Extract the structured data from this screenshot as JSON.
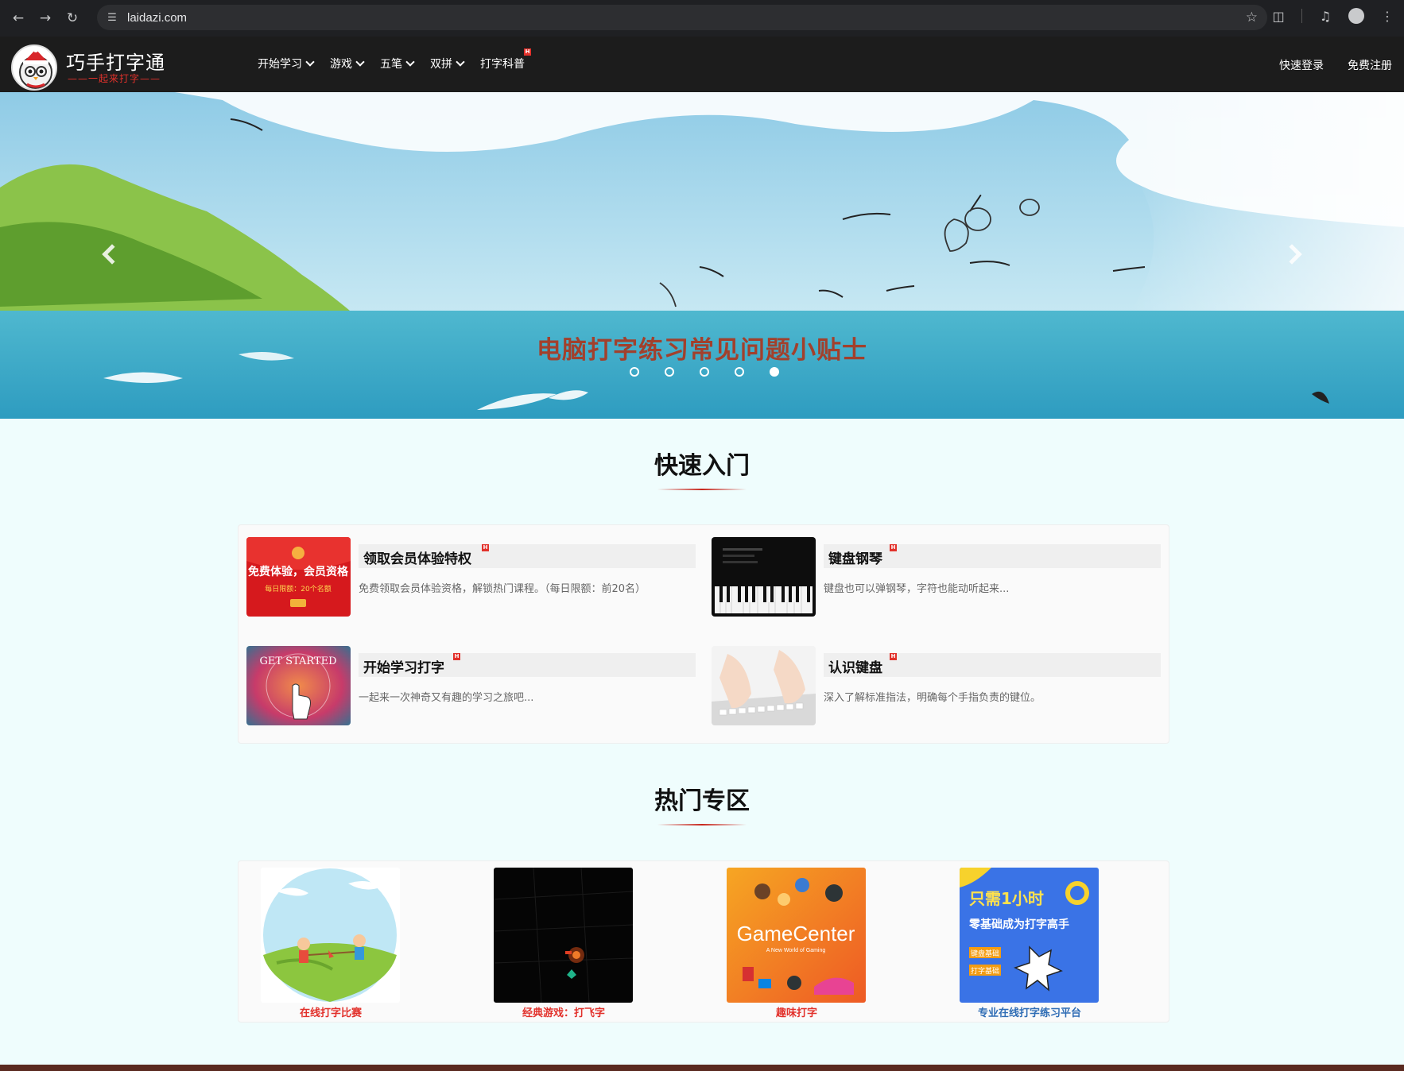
{
  "browser": {
    "url": "laidazi.com",
    "icons": [
      "back-icon",
      "forward-icon",
      "reload-icon",
      "site-info-icon",
      "bookmark-star-icon",
      "extensions-icon",
      "media-controls-icon",
      "profile-icon",
      "more-menu-icon"
    ]
  },
  "site": {
    "logo_title": "巧手打字通",
    "logo_subtitle": "——一起来打字——",
    "menu": [
      {
        "label": "开始学习",
        "dropdown": true,
        "hot": false
      },
      {
        "label": "游戏",
        "dropdown": true,
        "hot": false
      },
      {
        "label": "五笔",
        "dropdown": true,
        "hot": false
      },
      {
        "label": "双拼",
        "dropdown": true,
        "hot": false
      },
      {
        "label": "打字科普",
        "dropdown": false,
        "hot": true
      }
    ],
    "login": "快速登录",
    "register": "免费注册",
    "hot_badge": "H"
  },
  "banner": {
    "caption": "电脑打字练习常见问题小贴士",
    "slides": 5,
    "active_slide": 5
  },
  "quick_start": {
    "title": "快速入门",
    "items": [
      {
        "name": "领取会员体验特权",
        "desc": "免费领取会员体验资格，解锁热门课程。（每日限额：前20名）",
        "thumb_text": "免费体验，会员资格",
        "thumb_sub": "每日限额：20个名额"
      },
      {
        "name": "键盘钢琴",
        "desc": "键盘也可以弹钢琴，字符也能动听起来...",
        "thumb_text": "",
        "thumb_sub": ""
      },
      {
        "name": "开始学习打字",
        "desc": "一起来一次神奇又有趣的学习之旅吧...",
        "thumb_text": "GET STARTED",
        "thumb_sub": ""
      },
      {
        "name": "认识键盘",
        "desc": "深入了解标准指法，明确每个手指负责的键位。",
        "thumb_text": "",
        "thumb_sub": ""
      }
    ]
  },
  "hot_zone": {
    "title": "热门专区",
    "items": [
      {
        "label": "在线打字比赛",
        "color": "#e2312b"
      },
      {
        "label": "经典游戏：打飞字",
        "color": "#e2312b"
      },
      {
        "label": "趣味打字",
        "color": "#e2312b"
      },
      {
        "label": "专业在线打字练习平台",
        "color": "#2f6db5"
      }
    ],
    "gamecenter_text": "GameCenter",
    "gamecenter_sub": "A New World of Gaming",
    "promo_title": "只需1小时",
    "promo_sub": "零基础成为打字高手",
    "promo_tag1": "键盘基础",
    "promo_tag2": "打字基础"
  }
}
